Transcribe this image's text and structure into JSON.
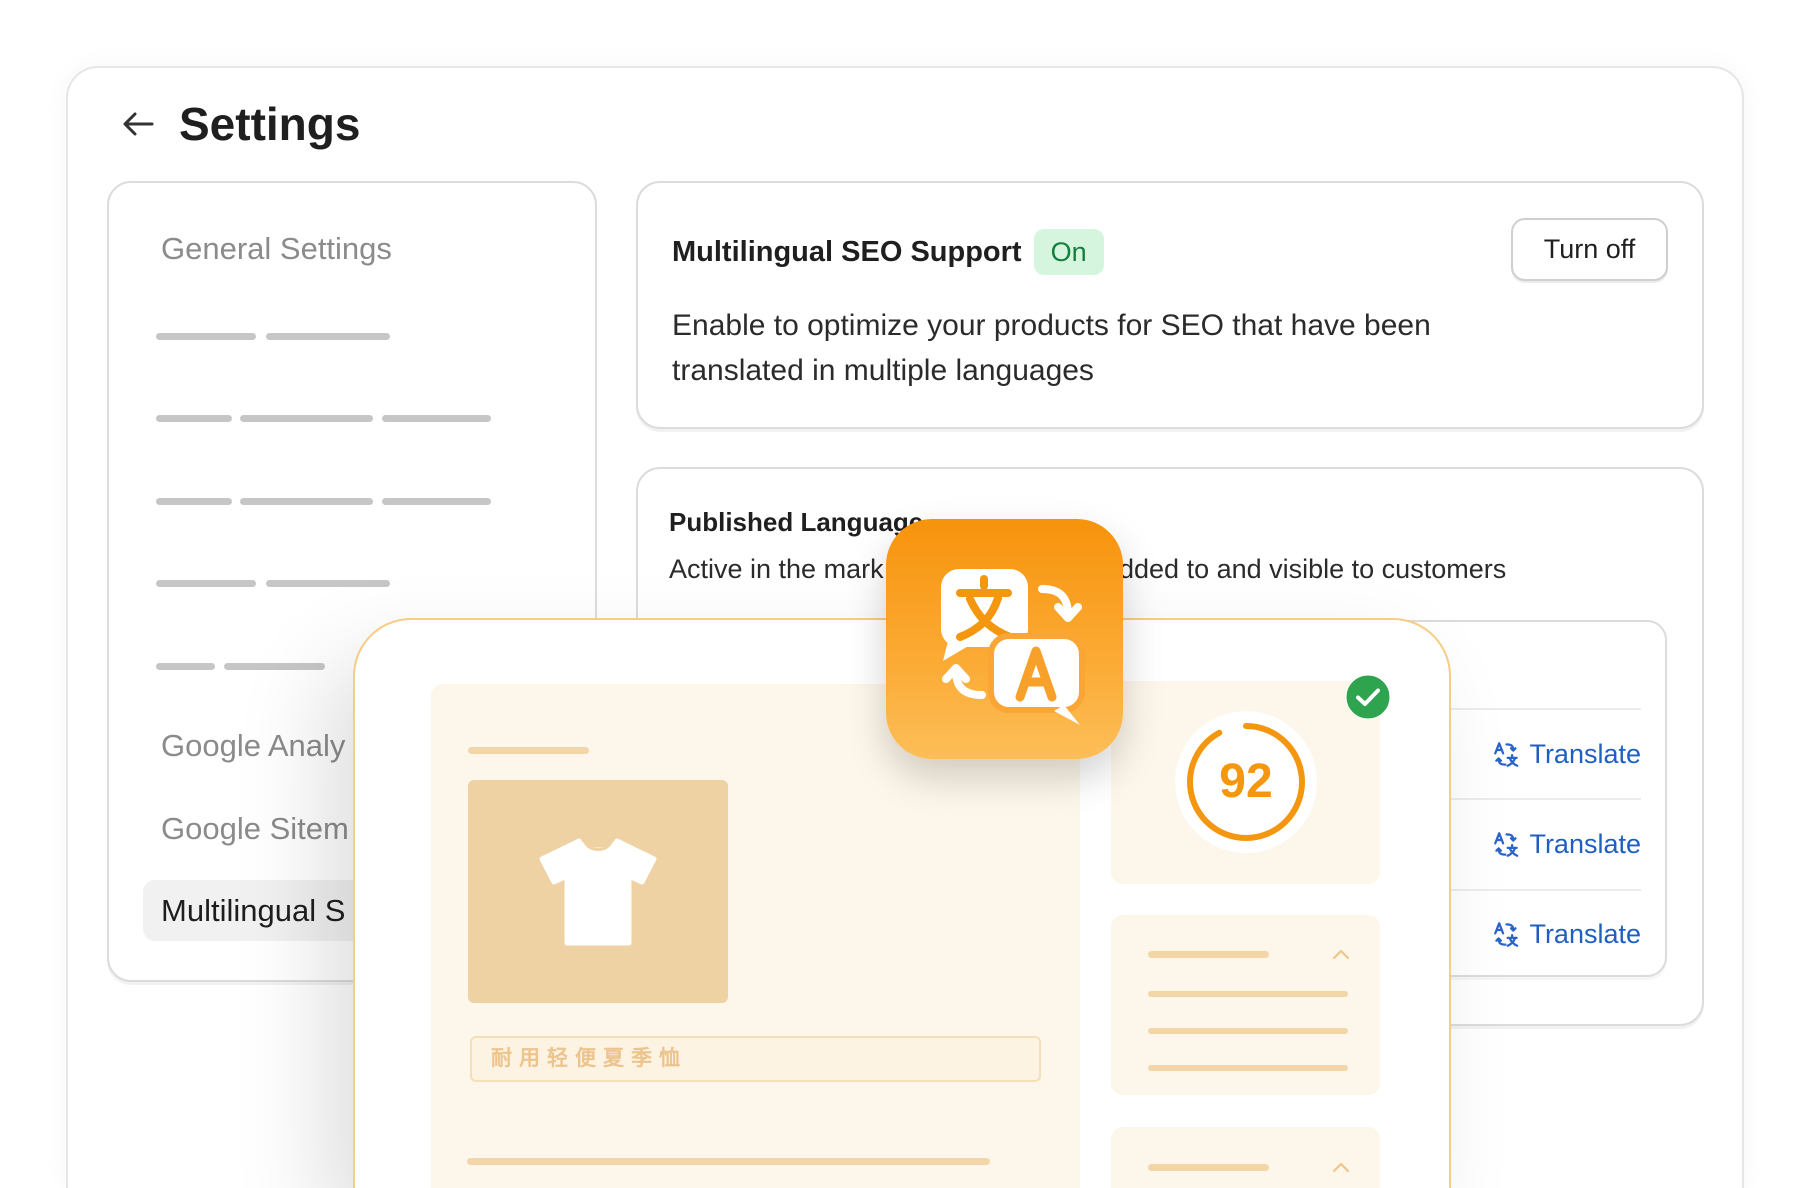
{
  "header": {
    "title": "Settings",
    "back_icon": "arrow-left-icon"
  },
  "sidebar": {
    "heading": "General Settings",
    "items": [
      {
        "label": "Google Analy",
        "selected": false
      },
      {
        "label": "Google Sitem",
        "selected": false
      },
      {
        "label": "Multilingual S",
        "selected": true
      }
    ]
  },
  "seo_card": {
    "title": "Multilingual SEO Support",
    "status": "On",
    "button": "Turn off",
    "description_line1": "Enable to optimize your products for SEO that have been",
    "description_line2": "translated in multiple languages"
  },
  "languages_card": {
    "title": "Published Language",
    "subtitle_start": "Active in the mark",
    "subtitle_end": "dded to and visible to customers",
    "rows": [
      {
        "action": "Translate",
        "icon": "translate-icon"
      },
      {
        "action": "Translate",
        "icon": "translate-icon"
      },
      {
        "action": "Translate",
        "icon": "translate-icon"
      }
    ]
  },
  "preview": {
    "product_title": "耐用轻便夏季恤",
    "product_image_icon": "tshirt-icon",
    "seo_score": "92",
    "score_status_icon": "check-circle-icon",
    "section_toggle_icon": "chevron-up-icon"
  },
  "app_icon": "translate-app-icon",
  "colors": {
    "accent": "#f5960f",
    "success": "#2ea44f",
    "link": "#1f5fc4",
    "badge_bg": "#d6f5de",
    "badge_text": "#12803a",
    "preview_border": "#f6cd84",
    "cream": "#fdf6ea",
    "tan": "#eed2a3"
  }
}
